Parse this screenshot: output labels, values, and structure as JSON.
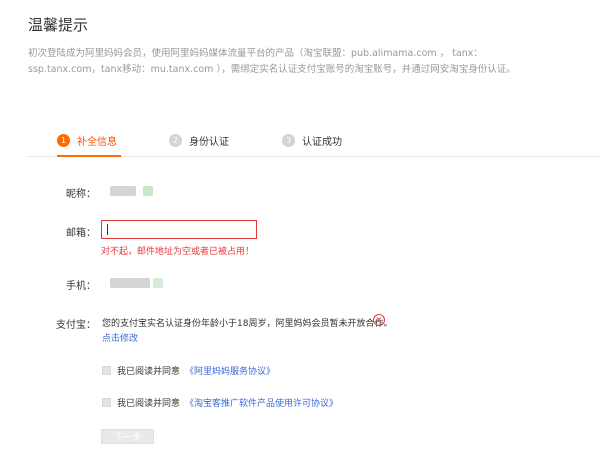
{
  "page": {
    "title": "温馨提示",
    "notice": "初次登陆成为阿里妈妈会员，使用阿里妈妈媒体流量平台的产品（淘宝联盟：pub.alimama.com ， tanx：ssp.tanx.com，tanx移动：mu.tanx.com ），需绑定实名认证支付宝账号的淘宝账号，并通过网安淘宝身份认证。"
  },
  "steps": [
    {
      "num": "1",
      "label": "补全信息"
    },
    {
      "num": "2",
      "label": "身份认证"
    },
    {
      "num": "3",
      "label": "认证成功"
    }
  ],
  "form": {
    "nickname_label": "昵称：",
    "email_label": "邮箱：",
    "email_value": "",
    "email_error": "对不起，邮件地址为空或者已被占用！",
    "phone_label": "手机：",
    "alipay_label": "支付宝：",
    "alipay_message": "您的支付宝实名认证身份年龄小于18周岁，阿里妈妈会员暂未开放合作。",
    "alipay_error_icon": "×",
    "edit_link": "点击修改",
    "agree1_text": "我已阅读并同意",
    "agree1_link": "《阿里妈妈服务协议》",
    "agree2_text": "我已阅读并同意",
    "agree2_link": "《淘宝客推广软件产品使用许可协议》",
    "next_button": "下一步"
  },
  "colors": {
    "accent": "#ff6a00",
    "error": "#e4393c",
    "link": "#3a6ad4"
  }
}
